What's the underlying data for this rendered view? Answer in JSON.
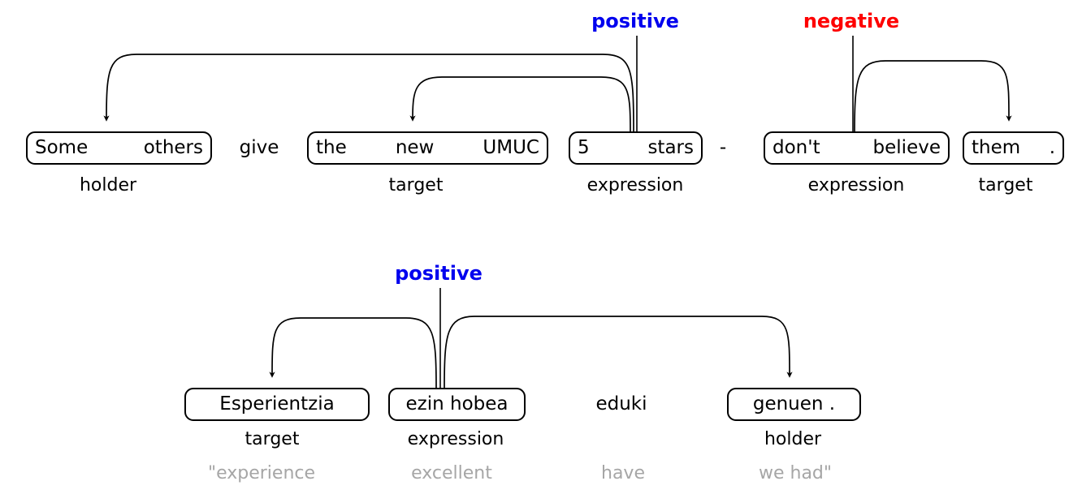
{
  "figure": {
    "kind": "structured-sentiment-graph",
    "colors": {
      "positive": "#0000ee",
      "negative": "#fe0000",
      "gloss": "#a6a6a6",
      "ink": "#000000",
      "background": "#ffffff"
    }
  },
  "examples": [
    {
      "id": "example-1",
      "language": "english",
      "polarities": [
        {
          "label": "positive",
          "sentiment": "positive"
        },
        {
          "label": "negative",
          "sentiment": "negative"
        }
      ],
      "spans": [
        {
          "text": "Some   others",
          "tokens": [
            "Some",
            "others"
          ],
          "role": "holder",
          "boxed": true
        },
        {
          "text": "give",
          "tokens": [
            "give"
          ],
          "role": "",
          "boxed": false
        },
        {
          "text": "the   new   UMUC",
          "tokens": [
            "the",
            "new",
            "UMUC"
          ],
          "role": "target",
          "boxed": true
        },
        {
          "text": "5   stars",
          "tokens": [
            "5",
            "stars"
          ],
          "role": "expression",
          "boxed": true
        },
        {
          "text": "-",
          "tokens": [
            "-"
          ],
          "role": "",
          "boxed": false
        },
        {
          "text": "don't   believe",
          "tokens": [
            "don't",
            "believe"
          ],
          "role": "expression",
          "boxed": true
        },
        {
          "text": "them   .",
          "tokens": [
            "them",
            "."
          ],
          "role": "target",
          "boxed": true
        }
      ]
    },
    {
      "id": "example-2",
      "language": "basque",
      "polarities": [
        {
          "label": "positive",
          "sentiment": "positive"
        }
      ],
      "spans": [
        {
          "text": "Esperientzia",
          "tokens": [
            "Esperientzia"
          ],
          "role": "target",
          "boxed": true,
          "gloss": "\"experience"
        },
        {
          "text": "ezin hobea",
          "tokens": [
            "ezin hobea"
          ],
          "role": "expression",
          "boxed": true,
          "gloss": "excellent"
        },
        {
          "text": "eduki",
          "tokens": [
            "eduki"
          ],
          "role": "",
          "boxed": false,
          "gloss": "have"
        },
        {
          "text": "genuen .",
          "tokens": [
            "genuen ."
          ],
          "role": "holder",
          "boxed": true,
          "gloss": "we had\""
        }
      ]
    }
  ],
  "row1": {
    "polarity_positive": "positive",
    "polarity_negative": "negative",
    "box1_tok1": "Some",
    "box1_tok2": "others",
    "box1_role": "holder",
    "word_give": "give",
    "box2_tok1": "the",
    "box2_tok2": "new",
    "box2_tok3": "UMUC",
    "box2_role": "target",
    "box3_tok1": "5",
    "box3_tok2": "stars",
    "box3_role": "expression",
    "word_dash": "-",
    "box4_tok1": "don't",
    "box4_tok2": "believe",
    "box4_role": "expression",
    "box5_tok1": "them",
    "box5_tok2": ".",
    "box5_role": "target"
  },
  "row2": {
    "polarity_positive": "positive",
    "box1_tok": "Esperientzia",
    "box1_role": "target",
    "box1_gloss": "\"experience",
    "box2_tok": "ezin hobea",
    "box2_role": "expression",
    "box2_gloss": "excellent",
    "word_eduki": "eduki",
    "word_eduki_gloss": "have",
    "box3_tok": "genuen .",
    "box3_role": "holder",
    "box3_gloss": "we had\""
  }
}
